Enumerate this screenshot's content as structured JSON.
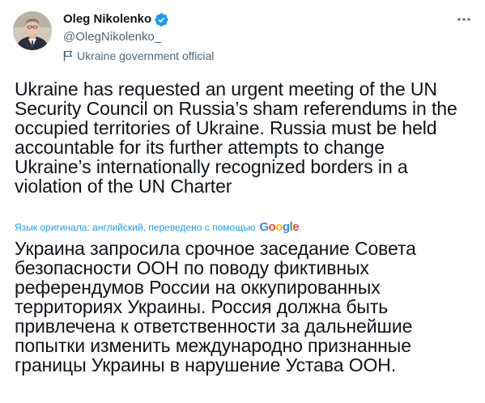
{
  "author": {
    "display_name": "Oleg Nikolenko",
    "handle": "@OlegNikolenko_",
    "label": "Ukraine government official"
  },
  "tweet": {
    "text": "Ukraine has requested an urgent meeting of the UN\nSecurity Council on Russia’s sham referendums in the\noccupied territories of Ukraine. Russia must be held\naccountable for its further attempts to change\nUkraine’s internationally recognized borders in a\nviolation of the UN Charter"
  },
  "translation": {
    "link_text": "Язык оригинала: английский, переведено с помощью",
    "provider": "Google",
    "text": "Украина запросила срочное заседание Совета\nбезопасности ООН по поводу фиктивных\nреферендумов России на оккупированных\nтерриториях Украины. Россия должна быть\nпривлечена к ответственности за дальнейшие\nпопытки изменить международно признанные\nграницы Украины в нарушение Устава ООН."
  },
  "colors": {
    "verified": "#1d9bf0",
    "link": "#1d9bf0",
    "secondary_text": "#536471",
    "primary_text": "#0f1419"
  },
  "icons": {
    "verified": "verified-badge-icon",
    "more": "more-horizontal-icon",
    "flag": "government-flag-icon"
  }
}
